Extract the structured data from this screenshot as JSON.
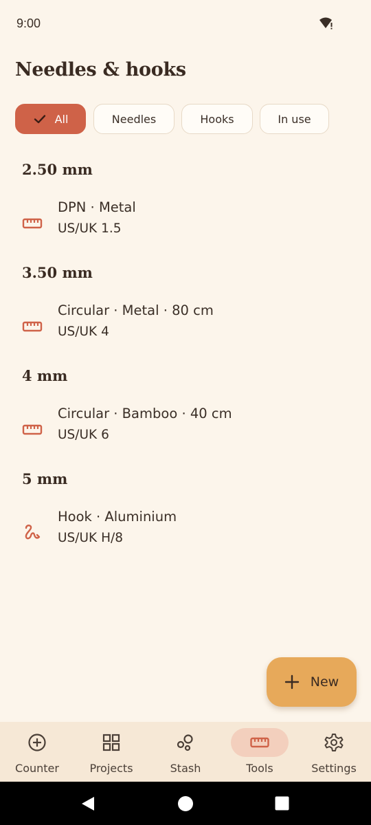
{
  "status_bar": {
    "time": "9:00"
  },
  "page": {
    "title": "Needles & hooks"
  },
  "filters": [
    {
      "label": "All",
      "selected": true
    },
    {
      "label": "Needles",
      "selected": false
    },
    {
      "label": "Hooks",
      "selected": false
    },
    {
      "label": "In use",
      "selected": false
    }
  ],
  "groups": [
    {
      "size": "2.50 mm",
      "items": [
        {
          "icon": "ruler-icon",
          "title": "DPN · Metal",
          "subtitle": "US/UK 1.5"
        }
      ]
    },
    {
      "size": "3.50 mm",
      "items": [
        {
          "icon": "ruler-icon",
          "title": "Circular · Metal · 80 cm",
          "subtitle": "US/UK 4"
        }
      ]
    },
    {
      "size": "4 mm",
      "items": [
        {
          "icon": "ruler-icon",
          "title": "Circular · Bamboo · 40 cm",
          "subtitle": "US/UK 6"
        }
      ]
    },
    {
      "size": "5 mm",
      "items": [
        {
          "icon": "hook-icon",
          "title": "Hook · Aluminium",
          "subtitle": "US/UK H/8"
        }
      ]
    }
  ],
  "fab": {
    "label": "New",
    "icon": "plus-icon"
  },
  "bottom_nav": [
    {
      "label": "Counter",
      "icon": "add-circle-icon",
      "active": false
    },
    {
      "label": "Projects",
      "icon": "grid-icon",
      "active": false
    },
    {
      "label": "Stash",
      "icon": "stash-icon",
      "active": false
    },
    {
      "label": "Tools",
      "icon": "ruler-icon",
      "active": true
    },
    {
      "label": "Settings",
      "icon": "gear-icon",
      "active": false
    }
  ],
  "colors": {
    "background": "#fcf5eb",
    "accent": "#cf6248",
    "fab": "#e7a95a",
    "nav_background": "#f6e8d6",
    "nav_active_pill": "#f3cfbd",
    "text": "#3a2e26"
  }
}
